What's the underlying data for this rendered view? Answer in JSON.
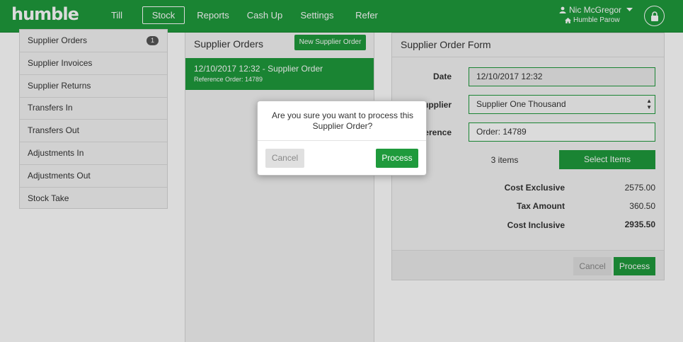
{
  "app": {
    "logo": "humble"
  },
  "nav": [
    {
      "label": "Till",
      "active": false
    },
    {
      "label": "Stock",
      "active": true
    },
    {
      "label": "Reports",
      "active": false
    },
    {
      "label": "Cash Up",
      "active": false
    },
    {
      "label": "Settings",
      "active": false
    },
    {
      "label": "Refer",
      "active": false
    }
  ],
  "user": {
    "name": "Nic McGregor",
    "store": "Humble Parow"
  },
  "icons": {
    "user": "user-icon",
    "dropdown": "caret-down-icon",
    "store": "home-icon",
    "lock": "lock-icon"
  },
  "sidebar": {
    "items": [
      {
        "label": "Supplier Orders",
        "badge": "1"
      },
      {
        "label": "Supplier Invoices"
      },
      {
        "label": "Supplier Returns"
      },
      {
        "label": "Transfers In"
      },
      {
        "label": "Transfers Out"
      },
      {
        "label": "Adjustments In"
      },
      {
        "label": "Adjustments Out"
      },
      {
        "label": "Stock Take"
      }
    ]
  },
  "orders_panel": {
    "title": "Supplier Orders",
    "new_button": "New Supplier Order",
    "orders": [
      {
        "title": "12/10/2017 12:32 - Supplier Order",
        "reference": "Reference Order: 14789"
      }
    ]
  },
  "form": {
    "title": "Supplier Order Form",
    "date_label": "Date",
    "date_value": "12/10/2017 12:32",
    "supplier_label": "Supplier",
    "supplier_value": "Supplier One Thousand",
    "reference_label": "Reference",
    "reference_value": "Order: 14789",
    "items_count": "3 items",
    "select_items": "Select Items",
    "cost_exclusive_label": "Cost Exclusive",
    "cost_exclusive_value": "2575.00",
    "tax_amount_label": "Tax Amount",
    "tax_amount_value": "360.50",
    "cost_inclusive_label": "Cost Inclusive",
    "cost_inclusive_value": "2935.50",
    "cancel_label": "Cancel",
    "process_label": "Process"
  },
  "modal": {
    "message": "Are you sure you want to process this Supplier Order?",
    "cancel_label": "Cancel",
    "process_label": "Process"
  },
  "colors": {
    "brand_green": "#1f9a3c",
    "panel_bg": "#f4f4f4",
    "muted_button": "#e0e0e0"
  }
}
